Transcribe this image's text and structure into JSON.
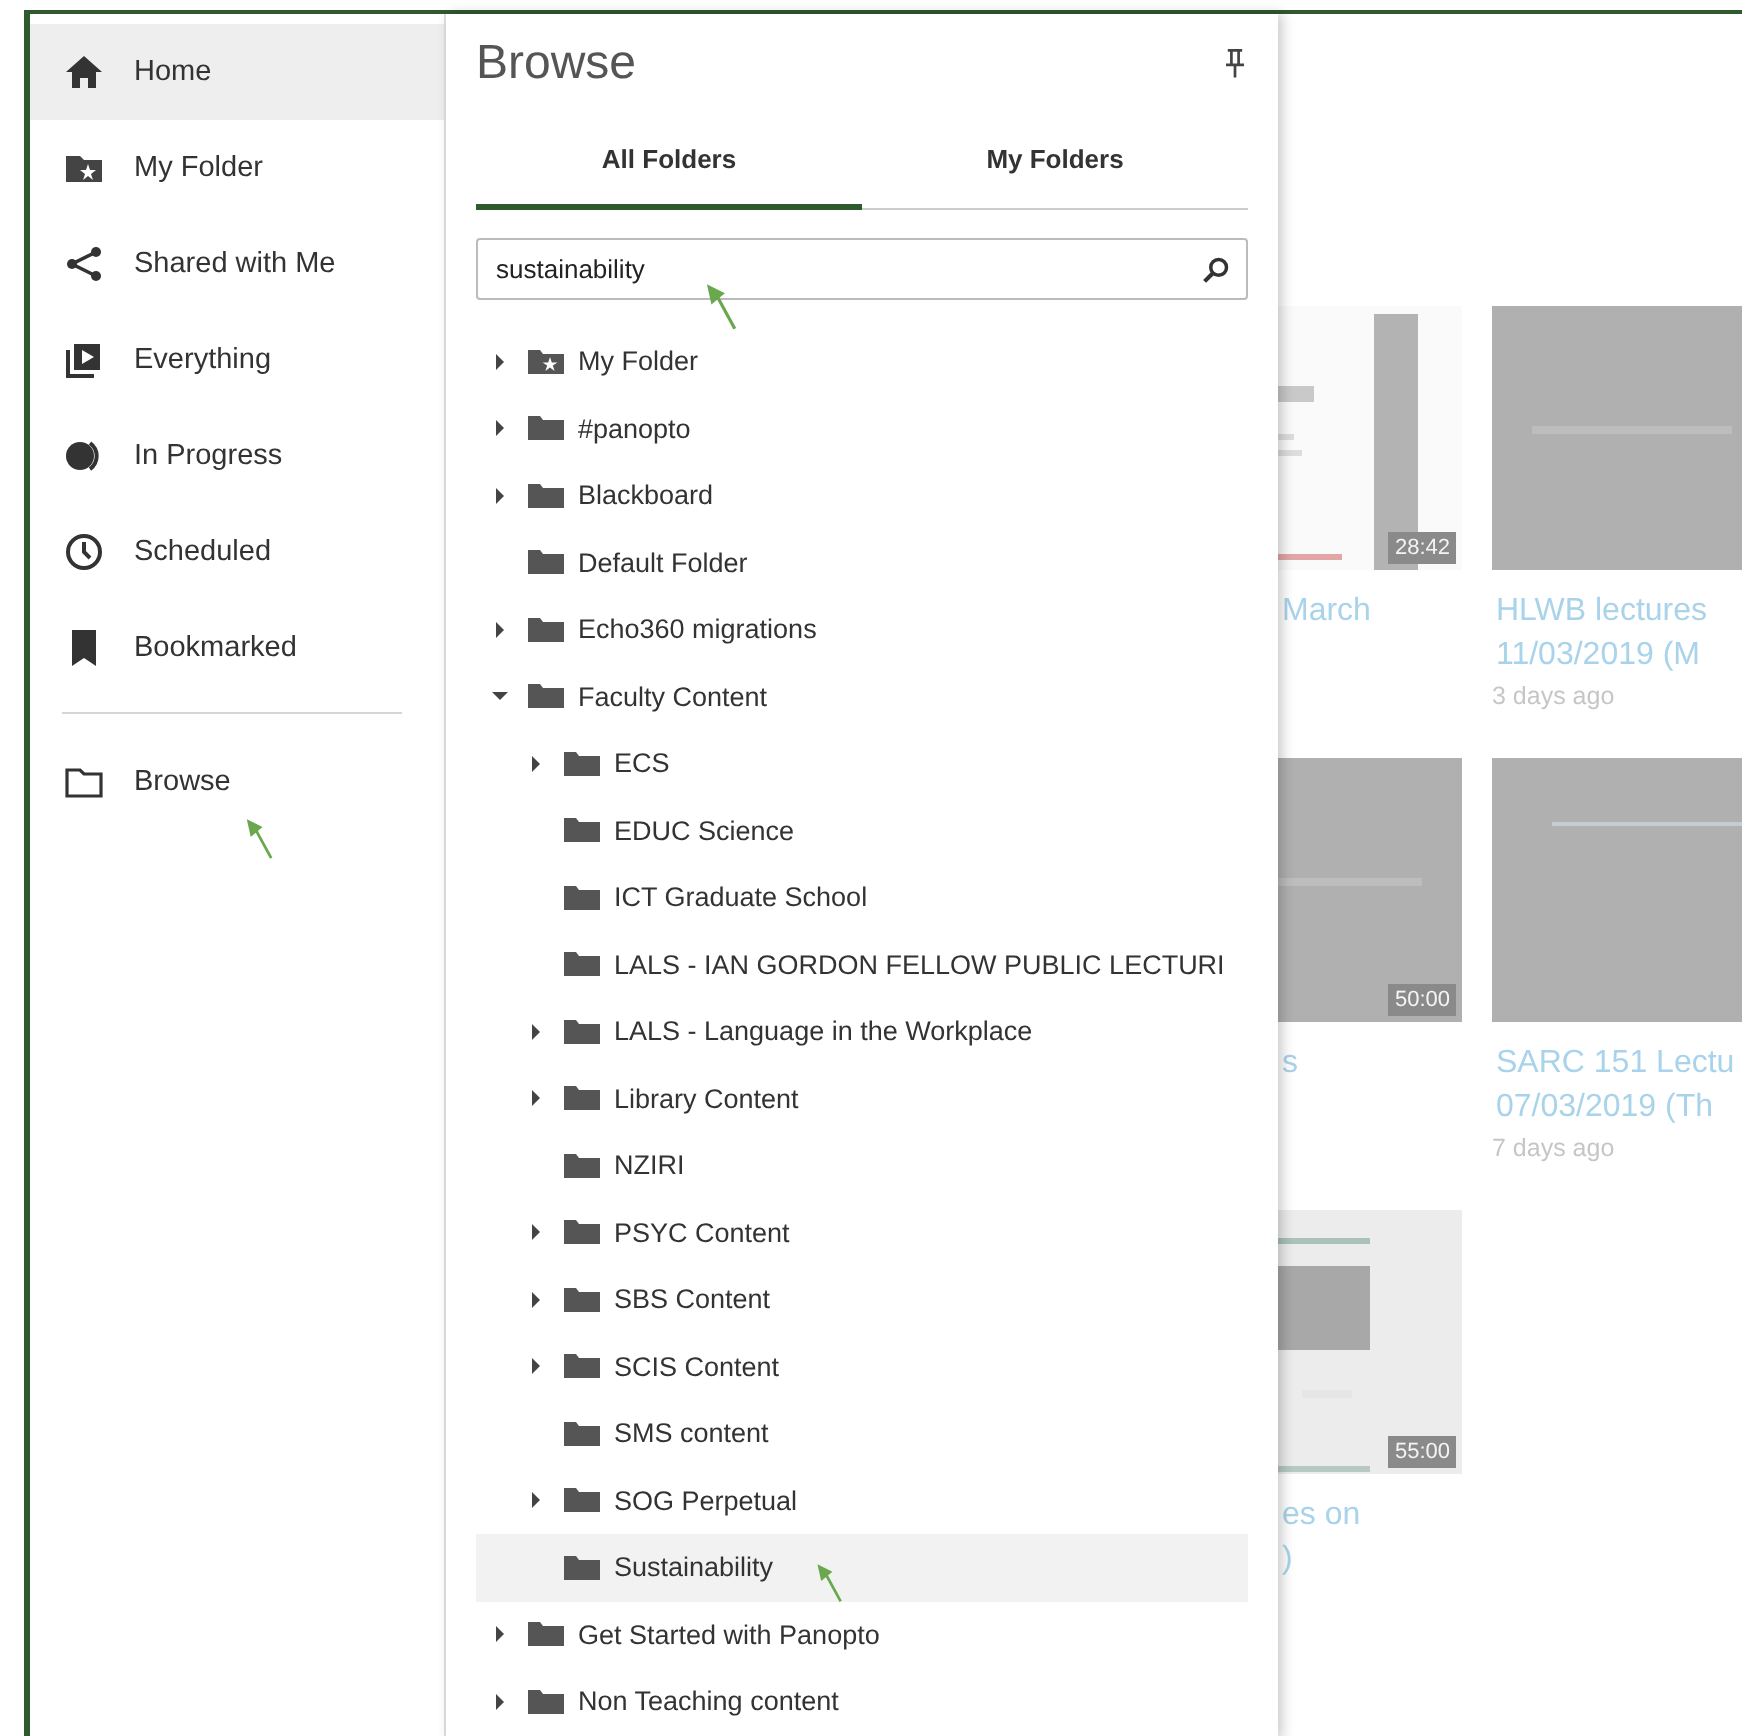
{
  "sidebar": {
    "items": [
      {
        "label": "Home",
        "selected": true
      },
      {
        "label": "My Folder",
        "selected": false
      },
      {
        "label": "Shared with Me",
        "selected": false
      },
      {
        "label": "Everything",
        "selected": false
      },
      {
        "label": "In Progress",
        "selected": false
      },
      {
        "label": "Scheduled",
        "selected": false
      },
      {
        "label": "Bookmarked",
        "selected": false
      }
    ],
    "footer_items": [
      {
        "label": "Browse",
        "selected": false
      }
    ]
  },
  "browse_panel": {
    "title": "Browse",
    "tabs": [
      {
        "label": "All Folders",
        "selected": true
      },
      {
        "label": "My Folders",
        "selected": false
      }
    ],
    "search": {
      "value": "sustainability"
    },
    "tree": [
      {
        "label": "My Folder",
        "kind": "personal",
        "has_children": true,
        "expanded": false,
        "selected": false
      },
      {
        "label": "#panopto",
        "kind": "folder",
        "has_children": true,
        "expanded": false,
        "selected": false
      },
      {
        "label": "Blackboard",
        "kind": "folder",
        "has_children": true,
        "expanded": false,
        "selected": false
      },
      {
        "label": "Default Folder",
        "kind": "folder",
        "has_children": false,
        "expanded": false,
        "selected": false
      },
      {
        "label": "Echo360 migrations",
        "kind": "folder",
        "has_children": true,
        "expanded": false,
        "selected": false
      },
      {
        "label": "Faculty Content",
        "kind": "folder",
        "has_children": true,
        "expanded": true,
        "selected": false,
        "children": [
          {
            "label": "ECS",
            "kind": "folder",
            "has_children": true,
            "expanded": false,
            "selected": false
          },
          {
            "label": "EDUC Science",
            "kind": "folder",
            "has_children": false,
            "expanded": false,
            "selected": false
          },
          {
            "label": "ICT Graduate School",
            "kind": "folder",
            "has_children": false,
            "expanded": false,
            "selected": false
          },
          {
            "label": "LALS - IAN GORDON FELLOW PUBLIC LECTURI",
            "kind": "folder",
            "has_children": false,
            "expanded": false,
            "selected": false
          },
          {
            "label": "LALS - Language in the Workplace",
            "kind": "folder",
            "has_children": true,
            "expanded": false,
            "selected": false
          },
          {
            "label": "Library Content",
            "kind": "folder",
            "has_children": true,
            "expanded": false,
            "selected": false
          },
          {
            "label": "NZIRI",
            "kind": "folder",
            "has_children": false,
            "expanded": false,
            "selected": false
          },
          {
            "label": "PSYC Content",
            "kind": "folder",
            "has_children": true,
            "expanded": false,
            "selected": false
          },
          {
            "label": "SBS Content",
            "kind": "folder",
            "has_children": true,
            "expanded": false,
            "selected": false
          },
          {
            "label": "SCIS Content",
            "kind": "folder",
            "has_children": true,
            "expanded": false,
            "selected": false
          },
          {
            "label": "SMS content",
            "kind": "folder",
            "has_children": false,
            "expanded": false,
            "selected": false
          },
          {
            "label": "SOG Perpetual",
            "kind": "folder",
            "has_children": true,
            "expanded": false,
            "selected": false
          },
          {
            "label": "Sustainability",
            "kind": "folder",
            "has_children": false,
            "expanded": false,
            "selected": true
          }
        ]
      },
      {
        "label": "Get Started with Panopto",
        "kind": "folder",
        "has_children": true,
        "expanded": false,
        "selected": false
      },
      {
        "label": "Non Teaching content",
        "kind": "folder",
        "has_children": true,
        "expanded": false,
        "selected": false
      }
    ]
  },
  "content": {
    "cards": [
      {
        "duration": "28:42",
        "title_lines": [
          "March"
        ]
      },
      {
        "title_lines": [
          "HLWB lectures",
          "11/03/2019 (M"
        ],
        "age": "3 days ago"
      },
      {
        "duration": "50:00",
        "title_lines": [
          "s"
        ]
      },
      {
        "title_lines": [
          "SARC 151 Lectu",
          "07/03/2019 (Th"
        ],
        "age": "7 days ago"
      },
      {
        "duration": "55:00",
        "title_lines": [
          "es on",
          ")"
        ]
      }
    ]
  }
}
